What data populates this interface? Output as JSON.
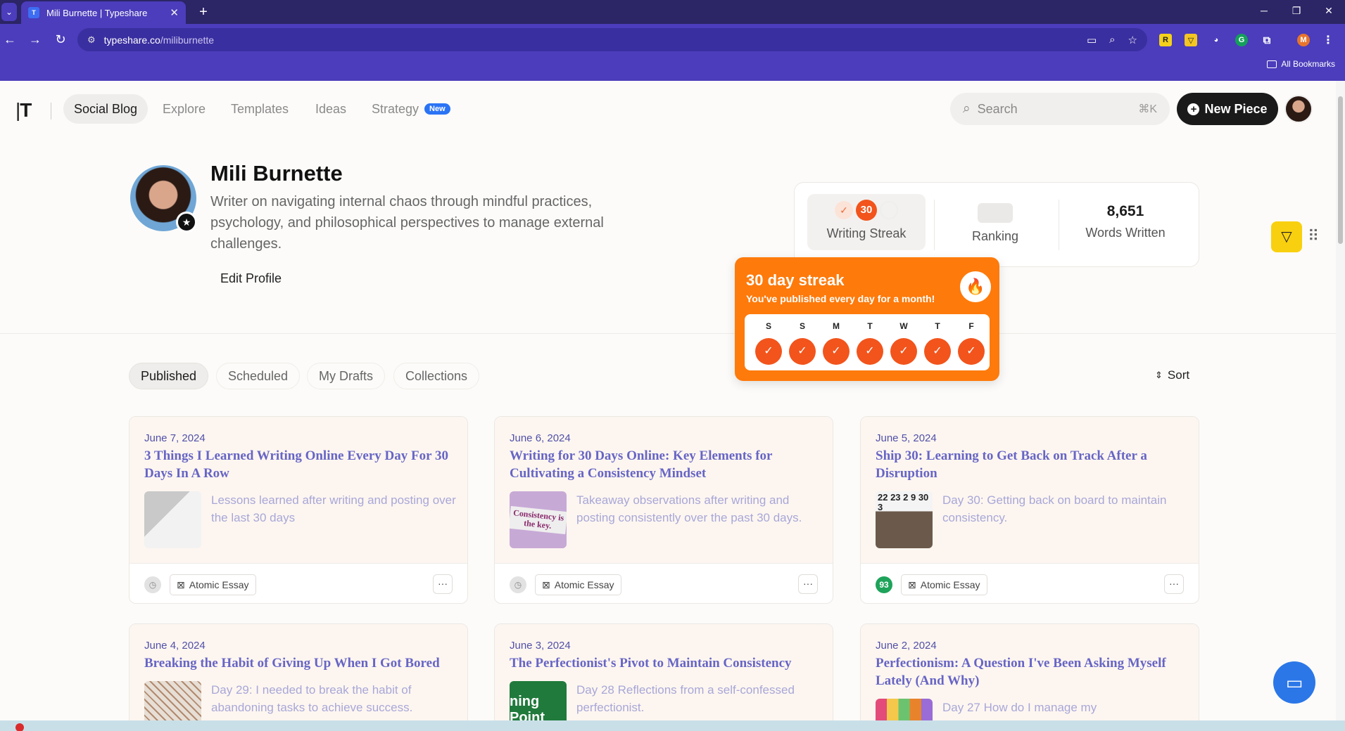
{
  "browser": {
    "tab_title": "Mili Burnette | Typeshare",
    "tab_favicon": "T",
    "url_domain": "typeshare.co",
    "url_path": "/miliburnette",
    "bookmarks_label": "All Bookmarks",
    "profile_initial": "M"
  },
  "site": {
    "logo": "T",
    "nav": [
      {
        "label": "Social Blog"
      },
      {
        "label": "Explore"
      },
      {
        "label": "Templates"
      },
      {
        "label": "Ideas"
      },
      {
        "label": "Strategy"
      }
    ],
    "nav_badge": "New",
    "search_placeholder": "Search",
    "search_shortcut": "⌘K",
    "new_piece_label": "New Piece"
  },
  "profile": {
    "name": "Mili Burnette",
    "bio": "Writer on navigating internal chaos through mindful practices, psychology, and philosophical perspectives to manage external challenges.",
    "edit_label": "Edit Profile"
  },
  "stats": {
    "streak_count": "30",
    "streak_label": "Writing Streak",
    "ranking_label": "Ranking",
    "words_value": "8,651",
    "words_label": "Words Written"
  },
  "streak_popup": {
    "title": "30 day streak",
    "subtitle": "You've published every day for a month!",
    "days": [
      "S",
      "S",
      "M",
      "T",
      "W",
      "T",
      "F"
    ]
  },
  "filters": {
    "tabs": [
      {
        "label": "Published"
      },
      {
        "label": "Scheduled"
      },
      {
        "label": "My Drafts"
      },
      {
        "label": "Collections"
      }
    ],
    "sort_label": "Sort"
  },
  "cards": [
    {
      "date": "June 7, 2024",
      "title": "3 Things I Learned Writing Online Every Day For 30 Days In A Row",
      "excerpt": "Lessons learned after writing and posting over the last 30 days",
      "type": "Atomic Essay",
      "score": ""
    },
    {
      "date": "June 6, 2024",
      "title": "Writing for 30 Days Online: Key Elements for Cultivating a Consistency Mindset",
      "excerpt": "Takeaway observations after writing and posting consistently over the past 30 days.",
      "type": "Atomic Essay",
      "score": "",
      "thumb_text": "Consistency is the key."
    },
    {
      "date": "June 5, 2024",
      "title": "Ship 30: Learning to Get Back on Track After a Disruption",
      "excerpt": "Day 30: Getting back on board to maintain consistency.",
      "type": "Atomic Essay",
      "score": "93",
      "thumb_text": "22 23 2 9 30 3"
    },
    {
      "date": "June 4, 2024",
      "title": "Breaking the Habit of Giving Up When I Got Bored",
      "excerpt": "Day 29: I needed to break the habit of abandoning tasks to achieve success."
    },
    {
      "date": "June 3, 2024",
      "title": "The Perfectionist's Pivot to Maintain Consistency",
      "excerpt": "Day 28 Reflections from a self-confessed perfectionist.",
      "thumb_text": "ning Point"
    },
    {
      "date": "June 2, 2024",
      "title": "Perfectionism: A Question I've Been Asking Myself Lately (And Why)",
      "excerpt": "Day 27 How do I manage my"
    }
  ]
}
